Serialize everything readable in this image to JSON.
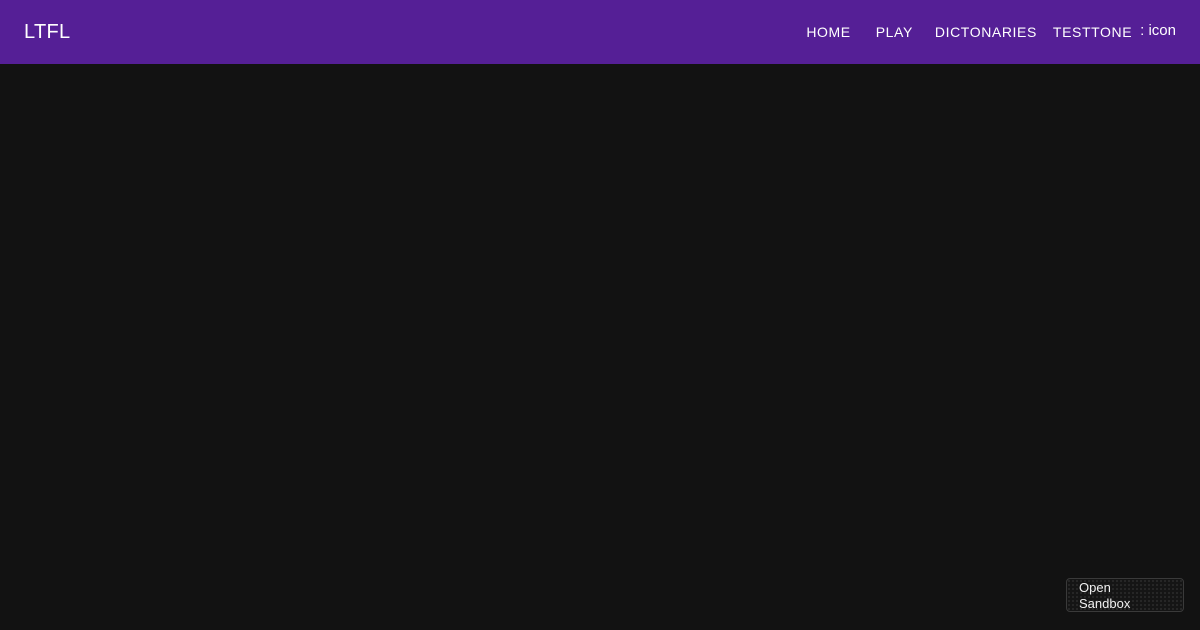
{
  "header": {
    "brand": "LTFL",
    "nav": [
      {
        "label": "HOME"
      },
      {
        "label": "PLAY"
      },
      {
        "label": "DICTONARIES"
      },
      {
        "label": "TESTTONE"
      }
    ],
    "menu_icon_text": ": icon"
  },
  "sandbox": {
    "line1": "Open",
    "line2": "Sandbox"
  },
  "colors": {
    "app_bar": "#551f96",
    "background": "#121212"
  }
}
